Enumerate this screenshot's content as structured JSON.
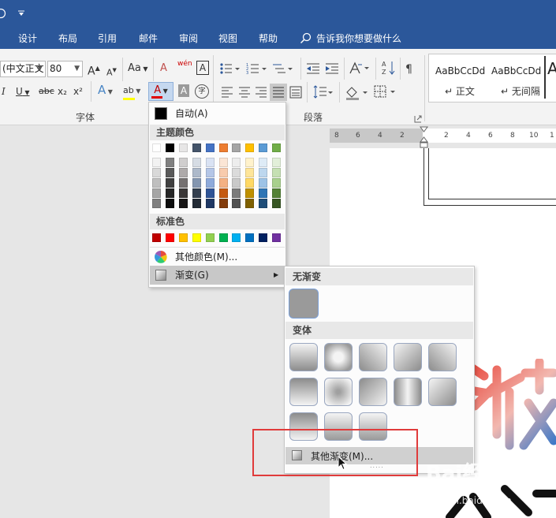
{
  "tabs": [
    "设计",
    "布局",
    "引用",
    "邮件",
    "审阅",
    "视图",
    "帮助"
  ],
  "tell_me": "告诉我你想要做什么",
  "font": {
    "name": "(中文正文",
    "size": "80"
  },
  "groups": {
    "font": "字体",
    "paragraph": "段落"
  },
  "styles": [
    {
      "preview": "AaBbCcDd",
      "name": "正文"
    },
    {
      "preview": "AaBbCcDd",
      "name": "无间隔"
    }
  ],
  "ribbon_glyphs": {
    "grow": "A",
    "shrink": "A",
    "case": "Aa",
    "clear": "A",
    "phonetic": "wén",
    "border": "A",
    "italic": "I",
    "underline": "U",
    "strike": "abc",
    "sub": "x₂",
    "sup": "x²",
    "effects": "A",
    "highlight": "ab",
    "color": "A",
    "shade": "A",
    "enclose": "字"
  },
  "ruler": [
    "8",
    "6",
    "4",
    "2",
    "2",
    "4",
    "6",
    "8",
    "10",
    "1"
  ],
  "menu": {
    "auto": "自动(A)",
    "theme_header": "主题颜色",
    "standard_header": "标准色",
    "more_colors": "其他颜色(M)...",
    "gradient": "渐变(G)"
  },
  "theme_colors_top": [
    "#ffffff",
    "#000000",
    "#e7e6e6",
    "#44546a",
    "#4472c4",
    "#ed7d31",
    "#a5a5a5",
    "#ffc000",
    "#5b9bd5",
    "#70ad47"
  ],
  "theme_shades": [
    [
      "#f2f2f2",
      "#d9d9d9",
      "#bfbfbf",
      "#a6a6a6",
      "#808080"
    ],
    [
      "#808080",
      "#595959",
      "#404040",
      "#262626",
      "#0d0d0d"
    ],
    [
      "#d0cece",
      "#aeaaaa",
      "#757171",
      "#3b3838",
      "#171616"
    ],
    [
      "#d6dce4",
      "#adb9ca",
      "#8496b0",
      "#333f4f",
      "#222a35"
    ],
    [
      "#d9e2f3",
      "#b4c6e7",
      "#8eaadb",
      "#2f5496",
      "#1f3864"
    ],
    [
      "#fbe5d5",
      "#f8cbad",
      "#f4b183",
      "#c55a11",
      "#833c0b"
    ],
    [
      "#ededed",
      "#dbdbdb",
      "#c9c9c9",
      "#7b7b7b",
      "#525252"
    ],
    [
      "#fff2cc",
      "#fee599",
      "#ffd965",
      "#bf9000",
      "#7f6000"
    ],
    [
      "#deebf6",
      "#bdd7ee",
      "#9dc3e6",
      "#2e75b5",
      "#1f4e79"
    ],
    [
      "#e2efd9",
      "#c5e0b3",
      "#a8d08d",
      "#538135",
      "#375623"
    ]
  ],
  "standard_colors": [
    "#c00000",
    "#ff0000",
    "#ffc000",
    "#ffff00",
    "#92d050",
    "#00b050",
    "#00b0f0",
    "#0070c0",
    "#002060",
    "#7030a0"
  ],
  "submenu": {
    "no_gradient": "无渐变",
    "variants": "变体",
    "more_gradients": "其他渐变(M)...",
    "more_dots": "....."
  },
  "watermark": {
    "brand": "Bai经验",
    "url": "jingyan.baidu.com"
  }
}
